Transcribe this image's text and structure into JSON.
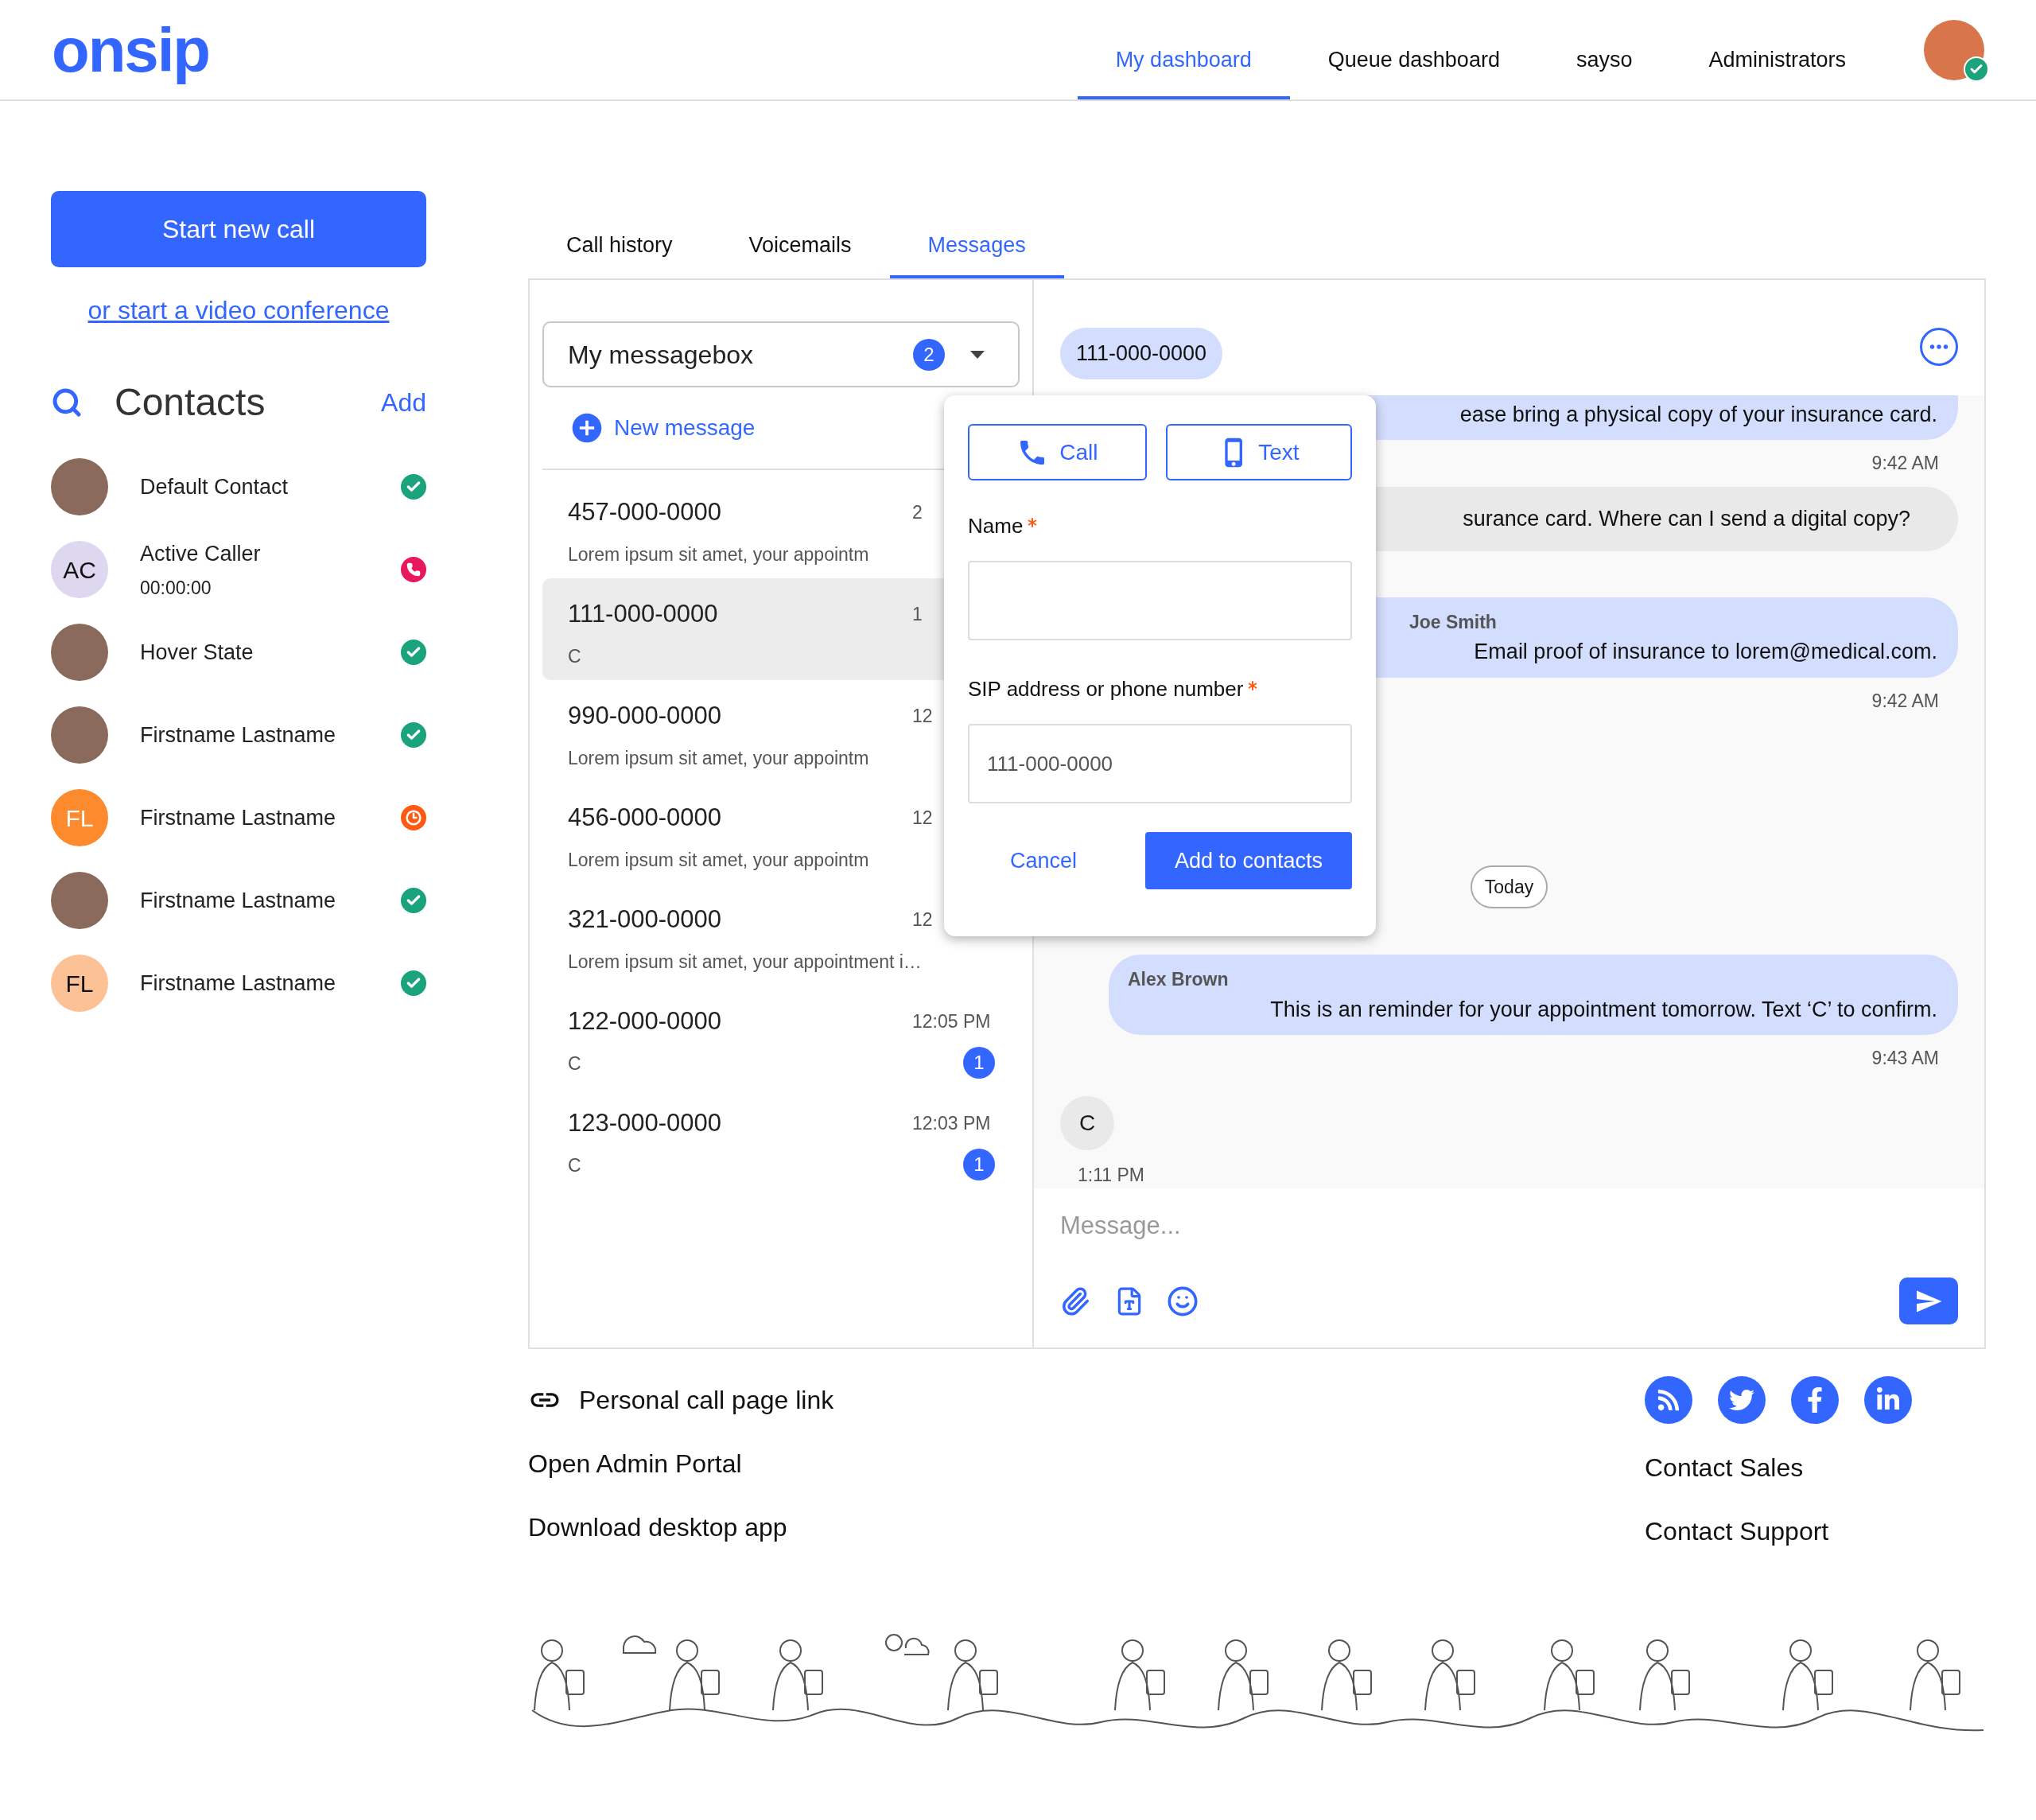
{
  "header": {
    "logo": "onsip",
    "nav": [
      {
        "label": "My dashboard",
        "selected": true
      },
      {
        "label": "Queue dashboard",
        "selected": false
      },
      {
        "label": "sayso",
        "selected": false
      },
      {
        "label": "Administrators",
        "selected": false
      }
    ]
  },
  "sidebar": {
    "start_call": "Start new call",
    "video_link": "or start a video conference",
    "contacts_title": "Contacts",
    "add": "Add",
    "contacts": [
      {
        "name": "Default Contact",
        "avatar": {
          "kind": "photo"
        },
        "status": {
          "kind": "check",
          "color": "#1ba37e"
        }
      },
      {
        "name": "Active Caller",
        "subtitle": "00:00:00",
        "avatar": {
          "kind": "initials",
          "initials": "AC",
          "color": "#ddd8f0"
        },
        "status": {
          "kind": "phone",
          "color": "#e8185f"
        }
      },
      {
        "name": "Hover State",
        "avatar": {
          "kind": "photo"
        },
        "status": {
          "kind": "check",
          "color": "#1ba37e"
        }
      },
      {
        "name": "Firstname Lastname",
        "avatar": {
          "kind": "photo"
        },
        "status": {
          "kind": "check",
          "color": "#1ba37e"
        }
      },
      {
        "name": "Firstname Lastname",
        "avatar": {
          "kind": "initials",
          "initials": "FL",
          "color": "#fd8a2c"
        },
        "status": {
          "kind": "clock",
          "color": "#fe5a13"
        }
      },
      {
        "name": "Firstname Lastname",
        "avatar": {
          "kind": "photo"
        },
        "status": {
          "kind": "check",
          "color": "#1ba37e"
        }
      },
      {
        "name": "Firstname Lastname",
        "avatar": {
          "kind": "initials",
          "initials": "FL",
          "color": "#fdc196"
        },
        "status": {
          "kind": "check",
          "color": "#1ba37e"
        }
      }
    ]
  },
  "tabs": [
    {
      "label": "Call history",
      "selected": false
    },
    {
      "label": "Voicemails",
      "selected": false
    },
    {
      "label": "Messages",
      "selected": true
    }
  ],
  "messagebox": {
    "label": "My messagebox",
    "count": "2"
  },
  "new_message": "New message",
  "threads": [
    {
      "number": "457-000-0000",
      "time": "2",
      "preview": "Lorem ipsum sit amet, your appointm",
      "selected": false
    },
    {
      "number": "111-000-0000",
      "time": "1",
      "preview": "C",
      "selected": true
    },
    {
      "number": "990-000-0000",
      "time": "12",
      "preview": "Lorem ipsum sit amet, your appointm",
      "selected": false
    },
    {
      "number": "456-000-0000",
      "time": "12",
      "preview": "Lorem ipsum sit amet, your appointm",
      "selected": false
    },
    {
      "number": "321-000-0000",
      "time": "12",
      "preview": "Lorem ipsum sit amet, your appointment i…",
      "selected": false
    },
    {
      "number": "122-000-0000",
      "time": "12:05 PM",
      "preview": "C",
      "unread": "1",
      "selected": false
    },
    {
      "number": "123-000-0000",
      "time": "12:03 PM",
      "preview": "C",
      "unread": "1",
      "selected": false
    }
  ],
  "chat": {
    "contact": "111-000-0000",
    "messages": [
      {
        "kind": "outgoing",
        "text": "ease bring a physical copy of your insurance card.",
        "time": "9:42 AM"
      },
      {
        "kind": "incoming",
        "text": "surance card. Where can I send a digital copy?"
      },
      {
        "kind": "outgoing",
        "sender": "Joe Smith",
        "text": "Email proof of insurance to lorem@medical.com.",
        "time": "9:42 AM"
      },
      {
        "kind": "divider",
        "text": "Today"
      },
      {
        "kind": "outgoing",
        "sender": "Alex Brown",
        "text": "This is an reminder for your appointment tomorrow. Text ‘C’ to confirm.",
        "time": "9:43 AM"
      },
      {
        "kind": "chip",
        "text": "C",
        "time": "1:11 PM"
      }
    ],
    "composer_placeholder": "Message..."
  },
  "popup": {
    "call": "Call",
    "text": "Text",
    "fields": [
      {
        "label": "Name",
        "required": true
      },
      {
        "label": "SIP address or phone number",
        "required": true,
        "value": "111-000-0000"
      }
    ],
    "cancel": "Cancel",
    "submit": "Add to contacts"
  },
  "footer": {
    "left": [
      {
        "label": "Personal call page link",
        "kind": "link-icon"
      },
      {
        "label": "Open Admin Portal"
      },
      {
        "label": "Download desktop app"
      }
    ],
    "right": [
      "Contact Sales",
      "Contact Support"
    ]
  }
}
